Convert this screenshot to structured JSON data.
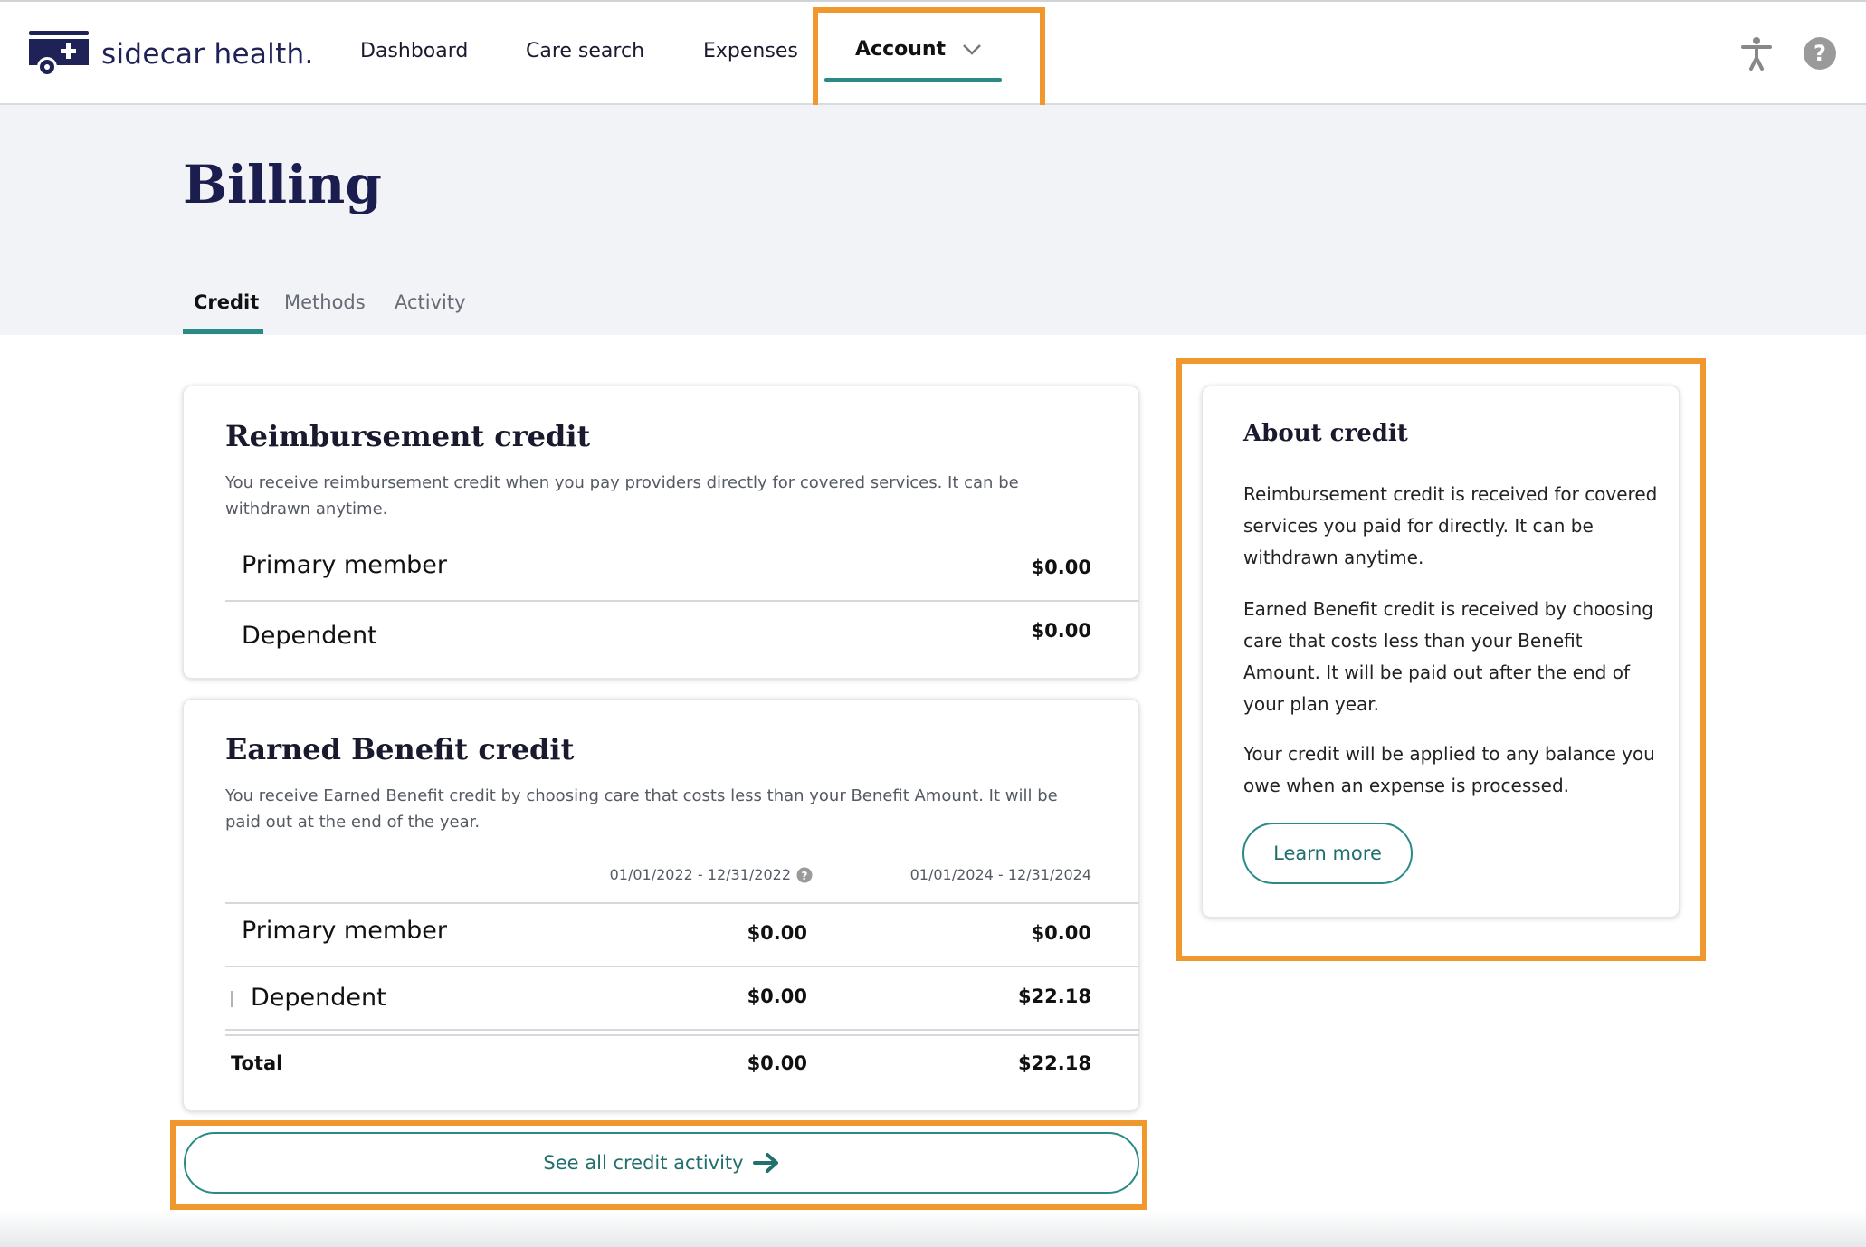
{
  "header": {
    "logo_text": "sidecar health.",
    "nav": [
      {
        "label": "Dashboard"
      },
      {
        "label": "Care search"
      },
      {
        "label": "Expenses"
      },
      {
        "label": "Account"
      }
    ],
    "icons": [
      "accessibility-icon",
      "help-icon"
    ]
  },
  "page": {
    "title": "Billing",
    "tabs": [
      {
        "label": "Credit",
        "active": true
      },
      {
        "label": "Methods",
        "active": false
      },
      {
        "label": "Activity",
        "active": false
      }
    ]
  },
  "reimbursement": {
    "title": "Reimbursement credit",
    "description": "You receive reimbursement credit when you pay providers directly for covered services. It can be withdrawn anytime.",
    "rows": [
      {
        "label": "Primary member",
        "value": "$0.00"
      },
      {
        "label": "Dependent",
        "value": "$0.00"
      }
    ]
  },
  "earned": {
    "title": "Earned Benefit credit",
    "description": "You receive Earned Benefit credit by choosing care that costs less than your Benefit Amount. It will be paid out at the end of the year.",
    "columns": [
      "01/01/2022 - 12/31/2022",
      "01/01/2024 - 12/31/2024"
    ],
    "rows": [
      {
        "label": "Primary member",
        "values": [
          "$0.00",
          "$0.00"
        ]
      },
      {
        "label": "Dependent",
        "values": [
          "$0.00",
          "$22.18"
        ]
      }
    ],
    "total": {
      "label": "Total",
      "values": [
        "$0.00",
        "$22.18"
      ]
    }
  },
  "see_all": {
    "label": "See all credit activity"
  },
  "about": {
    "title": "About credit",
    "paragraphs": [
      "Reimbursement credit is received for covered services you paid for directly. It can be withdrawn anytime.",
      "Earned Benefit credit is received by choosing care that costs less than your Benefit Amount. It will be paid out after the end of your plan year.",
      "Your credit will be applied to any balance you owe when an expense is processed."
    ],
    "button": "Learn more"
  },
  "colors": {
    "brand_navy": "#1f2257",
    "accent_teal": "#2a8a86",
    "highlight_orange": "#f0972e",
    "hero_bg": "#f1f3f6"
  }
}
